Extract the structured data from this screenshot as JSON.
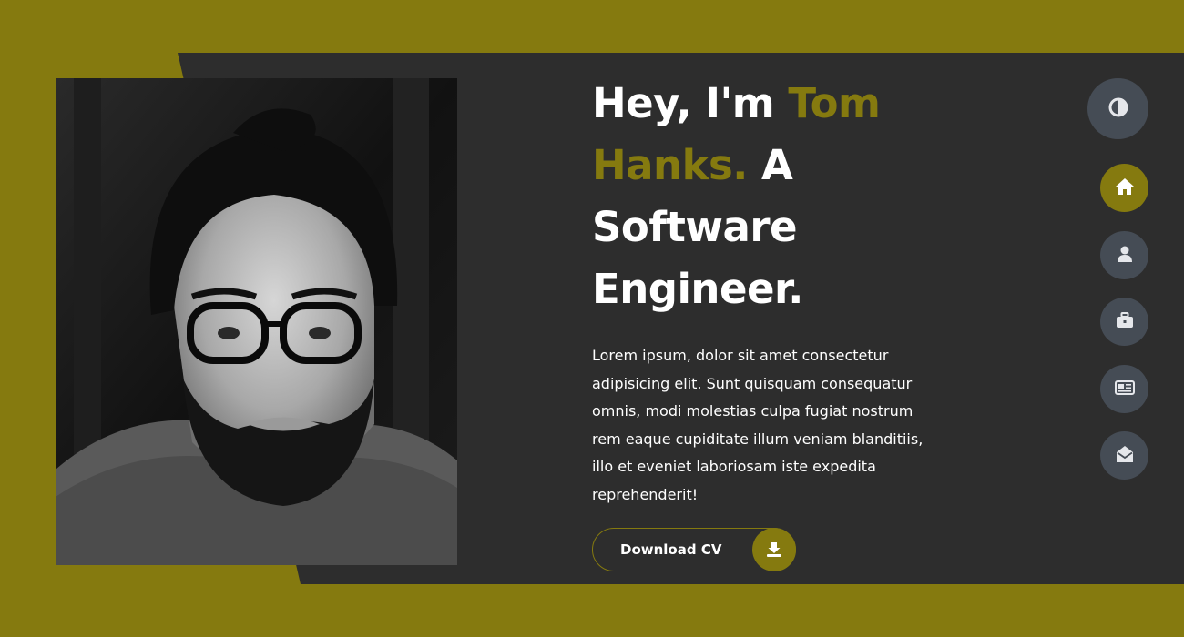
{
  "hero": {
    "greeting": "Hey, I'm ",
    "name": "Tom Hanks.",
    "role": " A Software Engineer.",
    "bio": "Lorem ipsum, dolor sit amet consectetur adipisicing elit. Sunt quisquam consequatur omnis, modi molestias culpa fugiat nostrum rem eaque cupiditate illum veniam blanditiis, illo et eveniet laboriosam iste expedita reprehenderit!",
    "download_label": "Download CV",
    "download_icon": "download-icon"
  },
  "controls": {
    "theme_icon": "contrast-icon",
    "nav": [
      {
        "icon": "home-icon",
        "active": true
      },
      {
        "icon": "user-icon",
        "active": false
      },
      {
        "icon": "briefcase-icon",
        "active": false
      },
      {
        "icon": "newspaper-icon",
        "active": false
      },
      {
        "icon": "envelope-open-icon",
        "active": false
      }
    ]
  },
  "colors": {
    "accent": "#857a0f",
    "panel": "#2d2d2d",
    "control_bg": "#454c55",
    "text": "#ffffff"
  }
}
